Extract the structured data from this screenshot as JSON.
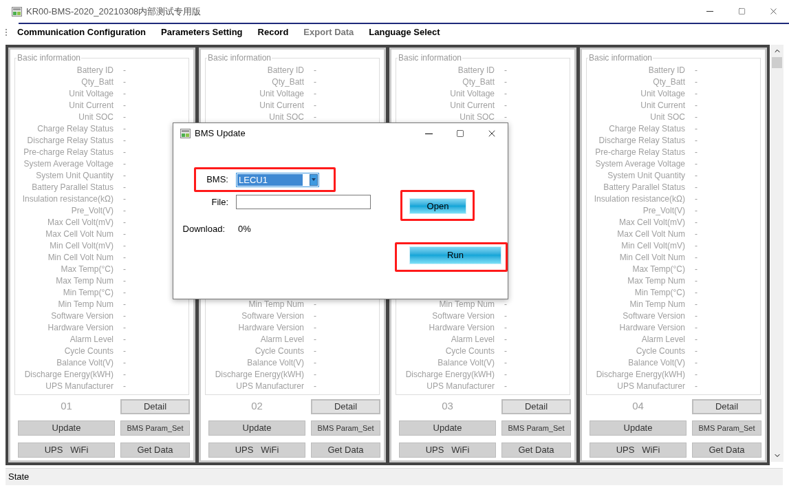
{
  "window": {
    "title": "KR00-BMS-2020_20210308内部测试专用版"
  },
  "menu": [
    {
      "label": "Communication Configuration",
      "disabled": false
    },
    {
      "label": "Parameters Setting",
      "disabled": false
    },
    {
      "label": "Record",
      "disabled": false
    },
    {
      "label": "Export Data",
      "disabled": true
    },
    {
      "label": "Language Select",
      "disabled": false
    }
  ],
  "panels": [
    {
      "group_title": "Basic information",
      "rows_top": [
        "Battery ID",
        "Qty_Batt",
        "Unit Voltage",
        "Unit Current",
        "Unit SOC",
        "Charge Relay Status",
        "Discharge Relay Status",
        "Pre-charge Relay Status",
        "System Average Voltage",
        "System Unit Quantity",
        "Battery Parallel Status",
        "Insulation resistance(kΩ)",
        "Pre_Volt(V)",
        "Max Cell Volt(mV)",
        "Max Cell Volt Num",
        "Min Cell Volt(mV)",
        "Min Cell Volt Num",
        "Max Temp(°C)",
        "Max Temp Num",
        "Min Temp(°C)",
        "Min Temp Num",
        "Software Version",
        "Hardware Version",
        "Alarm Level",
        "Cycle Counts",
        "Balance Volt(V)",
        "Discharge Energy(kWH)",
        "UPS Manufacturer"
      ],
      "value": "-",
      "number": "01",
      "buttons": [
        "Detail",
        "Update",
        "BMS Param_Set",
        "UPS   WiFi",
        "Get Data"
      ]
    },
    {
      "group_title": "Basic information",
      "rows_top": [
        "Battery ID",
        "Qty_Batt",
        "Unit Voltage",
        "Unit Current",
        "Unit SOC"
      ],
      "rows_bottom": [
        "Min Temp Num",
        "Software Version",
        "Hardware Version",
        "Alarm Level",
        "Cycle Counts",
        "Balance Volt(V)",
        "Discharge Energy(kWH)",
        "UPS Manufacturer"
      ],
      "value": "-",
      "number": "02",
      "buttons": [
        "Detail",
        "Update",
        "BMS Param_Set",
        "UPS   WiFi",
        "Get Data"
      ]
    },
    {
      "group_title": "Basic information",
      "rows_top": [
        "Battery ID",
        "Qty_Batt",
        "Unit Voltage",
        "Unit Current",
        "Unit SOC"
      ],
      "rows_bottom": [
        "Min Temp Num",
        "Software Version",
        "Hardware Version",
        "Alarm Level",
        "Cycle Counts",
        "Balance Volt(V)",
        "Discharge Energy(kWH)",
        "UPS Manufacturer"
      ],
      "value": "-",
      "number": "03",
      "buttons": [
        "Detail",
        "Update",
        "BMS Param_Set",
        "UPS   WiFi",
        "Get Data"
      ]
    },
    {
      "group_title": "Basic information",
      "rows_top": [
        "Battery ID",
        "Qty_Batt",
        "Unit Voltage",
        "Unit Current",
        "Unit SOC",
        "Charge Relay Status",
        "Discharge Relay Status",
        "Pre-charge Relay Status",
        "System Average Voltage",
        "System Unit Quantity",
        "Battery Parallel Status",
        "Insulation resistance(kΩ)",
        "Pre_Volt(V)",
        "Max Cell Volt(mV)",
        "Max Cell Volt Num",
        "Min Cell Volt(mV)",
        "Min Cell Volt Num",
        "Max Temp(°C)",
        "Max Temp Num",
        "Min Temp(°C)",
        "Min Temp Num",
        "Software Version",
        "Hardware Version",
        "Alarm Level",
        "Cycle Counts",
        "Balance Volt(V)",
        "Discharge Energy(kWH)",
        "UPS Manufacturer"
      ],
      "value": "-",
      "number": "04",
      "buttons": [
        "Detail",
        "Update",
        "BMS Param_Set",
        "UPS   WiFi",
        "Get Data"
      ]
    }
  ],
  "dialog": {
    "title": "BMS Update",
    "bms": {
      "label": "BMS:",
      "value": "LECU1",
      "highlighted": true
    },
    "file": {
      "label": "File:"
    },
    "download": {
      "label": "Download:",
      "value": "0%"
    },
    "open_button": {
      "label": "Open",
      "highlighted": true
    },
    "run_button": {
      "label": "Run",
      "highlighted": true
    }
  },
  "status_bar": {
    "text": "State"
  }
}
